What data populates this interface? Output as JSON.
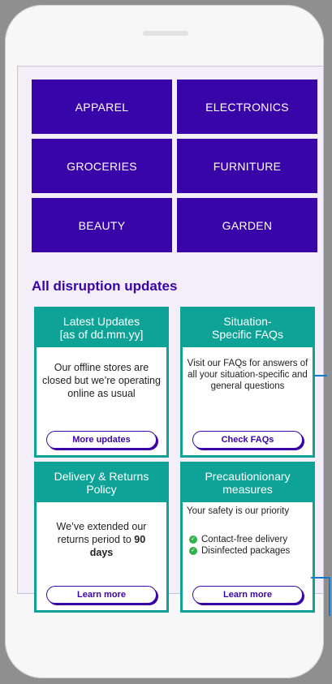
{
  "categories": {
    "apparel": "APPAREL",
    "electronics": "ELECTRONICS",
    "groceries": "GROCERIES",
    "furniture": "FURNITURE",
    "beauty": "BEAUTY",
    "garden": "GARDEN"
  },
  "section_title": "All disruption updates",
  "cards": {
    "latest": {
      "title_line1": "Latest Updates",
      "title_line2": "[as of dd.mm.yy]",
      "body": "Our offline stores are closed but we’re operating online as usual",
      "button": "More updates"
    },
    "faq": {
      "title_line1": "Situation-",
      "title_line2": "Specific FAQs",
      "body": "Visit our FAQs for answers of all your situation-specific and general questions",
      "button": "Check FAQs"
    },
    "delivery": {
      "title_line1": "Delivery & Returns",
      "title_line2": "Policy",
      "body_prefix": "We’ve extended our returns period to ",
      "body_bold": "90 days",
      "button": "Learn more"
    },
    "precaution": {
      "title_line1": "Precautionionary",
      "title_line2": "measures",
      "subtitle": "Your safety is our priority",
      "items": [
        "Contact-free delivery",
        "Disinfected packages"
      ],
      "button": "Learn more"
    }
  },
  "colors": {
    "brand_purple": "#3a05a8",
    "teal": "#0ea396",
    "check_green": "#2eb24a",
    "screen_bg": "#f3eef8"
  }
}
